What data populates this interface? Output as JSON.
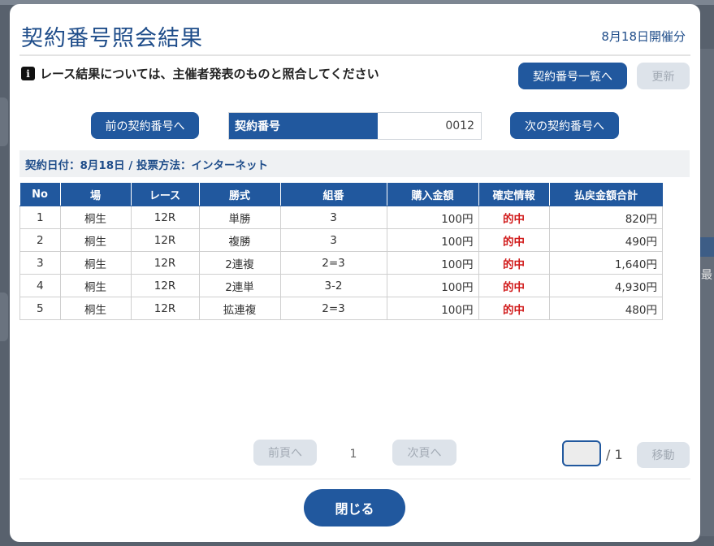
{
  "dialog": {
    "title": "契約番号照会結果",
    "date_label": "8月18日開催分",
    "notice": "レース結果については、主催者発表のものと照合してください"
  },
  "buttons": {
    "contract_list": "契約番号一覧へ",
    "refresh": "更新",
    "prev_contract": "前の契約番号へ",
    "next_contract": "次の契約番号へ",
    "prev_page": "前頁へ",
    "next_page": "次頁へ",
    "move": "移動",
    "close": "閉じる"
  },
  "contract": {
    "label": "契約番号",
    "value": "0012"
  },
  "meta": {
    "text": "契約日付：8月18日 / 投票方法：インターネット"
  },
  "table": {
    "headers": [
      "No",
      "場",
      "レース",
      "勝式",
      "組番",
      "購入金額",
      "確定情報",
      "払戻金額合計"
    ],
    "rows": [
      [
        "1",
        "桐生",
        "12R",
        "単勝",
        "3",
        "100円",
        "的中",
        "820円"
      ],
      [
        "2",
        "桐生",
        "12R",
        "複勝",
        "3",
        "100円",
        "的中",
        "490円"
      ],
      [
        "3",
        "桐生",
        "12R",
        "2連複",
        "2=3",
        "100円",
        "的中",
        "1,640円"
      ],
      [
        "4",
        "桐生",
        "12R",
        "2連単",
        "3-2",
        "100円",
        "的中",
        "4,930円"
      ],
      [
        "5",
        "桐生",
        "12R",
        "拡連複",
        "2=3",
        "100円",
        "的中",
        "480円"
      ]
    ]
  },
  "pager": {
    "current": "1",
    "total_label": "/ 1",
    "input_value": ""
  },
  "background": {
    "side_text": "最"
  },
  "colors": {
    "primary": "#21589e",
    "title": "#1f4d8a",
    "hit": "#d11b1b",
    "disabled": "#dde3ea"
  }
}
